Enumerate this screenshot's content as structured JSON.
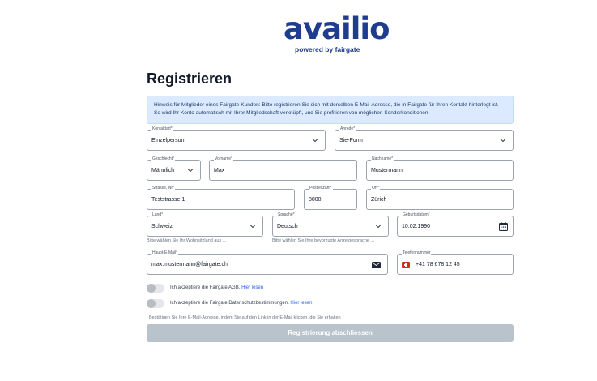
{
  "brand": {
    "name": "availio",
    "tagline": "powered by fairgate",
    "primary": "#1f3d8f",
    "accent": "#d71f2a"
  },
  "page": {
    "title": "Registrieren"
  },
  "notice": {
    "line1": "Hinweis für Mitglieder eines Fairgate-Kunden: Bitte registrieren Sie sich mit derselben E-Mail-Adresse, die in Fairgate für Ihren Kontakt hinterlegt ist.",
    "line2": "So wird Ihr Konto automatisch mit Ihrer Mitgliedschaft verknüpft, und Sie profitieren von möglichen Sonderkonditionen."
  },
  "form": {
    "kontaktart": {
      "label": "Kontaktart*",
      "value": "Einzelperson"
    },
    "anrede": {
      "label": "Anrede*",
      "value": "Sie-Form"
    },
    "geschlecht": {
      "label": "Geschlecht*",
      "value": "Männlich"
    },
    "vorname": {
      "label": "Vorname*",
      "value": "Max"
    },
    "nachname": {
      "label": "Nachname*",
      "value": "Mustermann"
    },
    "strasse": {
      "label": "Strasse, Nr*",
      "value": "Teststrasse 1"
    },
    "plz": {
      "label": "Postleitzahl*",
      "value": "8000"
    },
    "ort": {
      "label": "Ort*",
      "value": "Zürich"
    },
    "land": {
      "label": "Land*",
      "value": "Schweiz",
      "hint": "Bitte wählen Sie Ihr Wohnsitzland aus ..."
    },
    "sprache": {
      "label": "Sprache*",
      "value": "Deutsch",
      "hint": "Bitte wählen Sie Ihre bevorzugte Anzeigesprache ..."
    },
    "geburtsdatum": {
      "label": "Geburtsdatum*",
      "value": "10.02.1990"
    },
    "email": {
      "label": "Haupt-E-Mail*",
      "value": "max.mustermann@fairgate.ch"
    },
    "telefon": {
      "label": "Telefonnummer",
      "value": "+41 78 678 12 45"
    }
  },
  "consents": {
    "agb": {
      "text": "Ich akzeptiere die Fairgate AGB.",
      "link": "Hier lesen"
    },
    "datenschutz": {
      "text": "Ich akzeptiere die Fairgate Datenschutzbestimmungen.",
      "link": "Hier lesen"
    }
  },
  "confirm_text": "Bestätigen Sie Ihre E-Mail-Adresse, indem Sie auf den Link in der E-Mail klicken, die Sie erhalten",
  "submit_label": "Registrierung abschliessen"
}
